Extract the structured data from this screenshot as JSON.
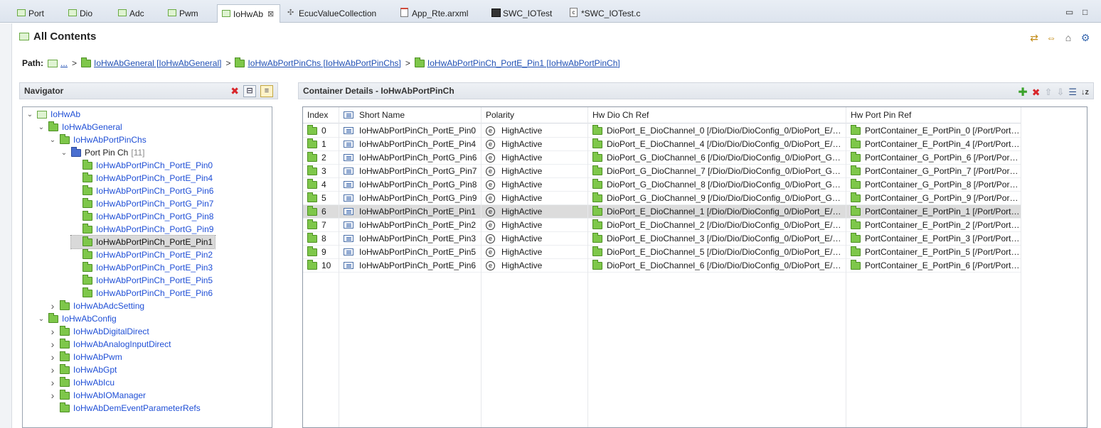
{
  "tabs": [
    {
      "label": "Port",
      "icon": "module-icon"
    },
    {
      "label": "Dio",
      "icon": "module-icon"
    },
    {
      "label": "Adc",
      "icon": "module-icon"
    },
    {
      "label": "Pwm",
      "icon": "module-icon"
    },
    {
      "label": "IoHwAb",
      "icon": "module-icon",
      "active": true,
      "close": "⊠"
    },
    {
      "label": "EcucValueCollection",
      "icon": "collection-icon"
    },
    {
      "label": "App_Rte.arxml",
      "icon": "arxml-file-icon"
    },
    {
      "label": "SWC_IOTest",
      "icon": "swc-icon"
    },
    {
      "label": "*SWC_IOTest.c",
      "icon": "c-file-icon"
    }
  ],
  "window": {
    "minimize": "▭",
    "maximize": "□"
  },
  "editor": {
    "title": "All Contents",
    "path_label": "Path:",
    "path": [
      "...",
      "IoHwAbGeneral [IoHwAbGeneral]",
      "IoHwAbPortPinChs [IoHwAbPortPinChs]",
      "IoHwAbPortPinCh_PortE_Pin1 [IoHwAbPortPinCh]"
    ],
    "path_sep": ">"
  },
  "navigator": {
    "title": "Navigator",
    "tree": [
      {
        "label": "IoHwAb",
        "tw": "v",
        "icon": "box",
        "depth": 0
      },
      {
        "label": "IoHwAbGeneral",
        "tw": "v",
        "icon": "folder",
        "depth": 1
      },
      {
        "label": "IoHwAbPortPinChs",
        "tw": "v",
        "icon": "folder",
        "depth": 2
      },
      {
        "label": "Port Pin Ch",
        "count": "[11]",
        "tw": "v",
        "icon": "folder-blue",
        "depth": 3,
        "black": true
      },
      {
        "label": "IoHwAbPortPinCh_PortE_Pin0",
        "tw": "",
        "icon": "folder",
        "depth": 4
      },
      {
        "label": "IoHwAbPortPinCh_PortE_Pin4",
        "tw": "",
        "icon": "folder",
        "depth": 4
      },
      {
        "label": "IoHwAbPortPinCh_PortG_Pin6",
        "tw": "",
        "icon": "folder",
        "depth": 4
      },
      {
        "label": "IoHwAbPortPinCh_PortG_Pin7",
        "tw": "",
        "icon": "folder",
        "depth": 4
      },
      {
        "label": "IoHwAbPortPinCh_PortG_Pin8",
        "tw": "",
        "icon": "folder",
        "depth": 4
      },
      {
        "label": "IoHwAbPortPinCh_PortG_Pin9",
        "tw": "",
        "icon": "folder",
        "depth": 4
      },
      {
        "label": "IoHwAbPortPinCh_PortE_Pin1",
        "tw": "",
        "icon": "folder",
        "depth": 4,
        "selected": true
      },
      {
        "label": "IoHwAbPortPinCh_PortE_Pin2",
        "tw": "",
        "icon": "folder",
        "depth": 4
      },
      {
        "label": "IoHwAbPortPinCh_PortE_Pin3",
        "tw": "",
        "icon": "folder",
        "depth": 4
      },
      {
        "label": "IoHwAbPortPinCh_PortE_Pin5",
        "tw": "",
        "icon": "folder",
        "depth": 4
      },
      {
        "label": "IoHwAbPortPinCh_PortE_Pin6",
        "tw": "",
        "icon": "folder",
        "depth": 4
      },
      {
        "label": "IoHwAbAdcSetting",
        "tw": ">",
        "icon": "folder",
        "depth": 2
      },
      {
        "label": "IoHwAbConfig",
        "tw": "v",
        "icon": "folder",
        "depth": 1
      },
      {
        "label": "IoHwAbDigitalDirect",
        "tw": ">",
        "icon": "folder",
        "depth": 2
      },
      {
        "label": "IoHwAbAnalogInputDirect",
        "tw": ">",
        "icon": "folder",
        "depth": 2
      },
      {
        "label": "IoHwAbPwm",
        "tw": ">",
        "icon": "folder",
        "depth": 2
      },
      {
        "label": "IoHwAbGpt",
        "tw": ">",
        "icon": "folder",
        "depth": 2
      },
      {
        "label": "IoHwAbIcu",
        "tw": ">",
        "icon": "folder",
        "depth": 2
      },
      {
        "label": "IoHwAbIOManager",
        "tw": ">",
        "icon": "folder",
        "depth": 2
      },
      {
        "label": "IoHwAbDemEventParameterRefs",
        "tw": "",
        "icon": "folder",
        "depth": 2
      }
    ]
  },
  "details": {
    "title": "Container Details - IoHwAbPortPinCh",
    "columns": [
      "Index",
      "Short Name",
      "Polarity",
      "Hw Dio Ch Ref",
      "Hw Port Pin Ref"
    ],
    "rows": [
      [
        "0",
        "IoHwAbPortPinCh_PortE_Pin0",
        "HighActive",
        "DioPort_E_DioChannel_0 [/Dio/Dio/DioConfig_0/DioPort_E/…",
        "PortContainer_E_PortPin_0 [/Port/Port…"
      ],
      [
        "1",
        "IoHwAbPortPinCh_PortE_Pin4",
        "HighActive",
        "DioPort_E_DioChannel_4 [/Dio/Dio/DioConfig_0/DioPort_E/…",
        "PortContainer_E_PortPin_4 [/Port/Port…"
      ],
      [
        "2",
        "IoHwAbPortPinCh_PortG_Pin6",
        "HighActive",
        "DioPort_G_DioChannel_6 [/Dio/Dio/DioConfig_0/DioPort_G…",
        "PortContainer_G_PortPin_6 [/Port/Por…"
      ],
      [
        "3",
        "IoHwAbPortPinCh_PortG_Pin7",
        "HighActive",
        "DioPort_G_DioChannel_7 [/Dio/Dio/DioConfig_0/DioPort_G…",
        "PortContainer_G_PortPin_7 [/Port/Por…"
      ],
      [
        "4",
        "IoHwAbPortPinCh_PortG_Pin8",
        "HighActive",
        "DioPort_G_DioChannel_8 [/Dio/Dio/DioConfig_0/DioPort_G…",
        "PortContainer_G_PortPin_8 [/Port/Por…"
      ],
      [
        "5",
        "IoHwAbPortPinCh_PortG_Pin9",
        "HighActive",
        "DioPort_G_DioChannel_9 [/Dio/Dio/DioConfig_0/DioPort_G…",
        "PortContainer_G_PortPin_9 [/Port/Por…"
      ],
      [
        "6",
        "IoHwAbPortPinCh_PortE_Pin1",
        "HighActive",
        "DioPort_E_DioChannel_1 [/Dio/Dio/DioConfig_0/DioPort_E/…",
        "PortContainer_E_PortPin_1 [/Port/Port…"
      ],
      [
        "7",
        "IoHwAbPortPinCh_PortE_Pin2",
        "HighActive",
        "DioPort_E_DioChannel_2 [/Dio/Dio/DioConfig_0/DioPort_E/…",
        "PortContainer_E_PortPin_2 [/Port/Port…"
      ],
      [
        "8",
        "IoHwAbPortPinCh_PortE_Pin3",
        "HighActive",
        "DioPort_E_DioChannel_3 [/Dio/Dio/DioConfig_0/DioPort_E/…",
        "PortContainer_E_PortPin_3 [/Port/Port…"
      ],
      [
        "9",
        "IoHwAbPortPinCh_PortE_Pin5",
        "HighActive",
        "DioPort_E_DioChannel_5 [/Dio/Dio/DioConfig_0/DioPort_E/…",
        "PortContainer_E_PortPin_5 [/Port/Port…"
      ],
      [
        "10",
        "IoHwAbPortPinCh_PortE_Pin6",
        "HighActive",
        "DioPort_E_DioChannel_6 [/Dio/Dio/DioConfig_0/DioPort_E/…",
        "PortContainer_E_PortPin_6 [/Port/Port…"
      ]
    ],
    "selected_row": 6
  },
  "colors": {
    "accent_link": "#1f4fd6",
    "folder_green": "#7ec74a",
    "folder_blue": "#4a6fd0",
    "delete_red": "#d8262a",
    "add_green": "#3aa22a"
  }
}
